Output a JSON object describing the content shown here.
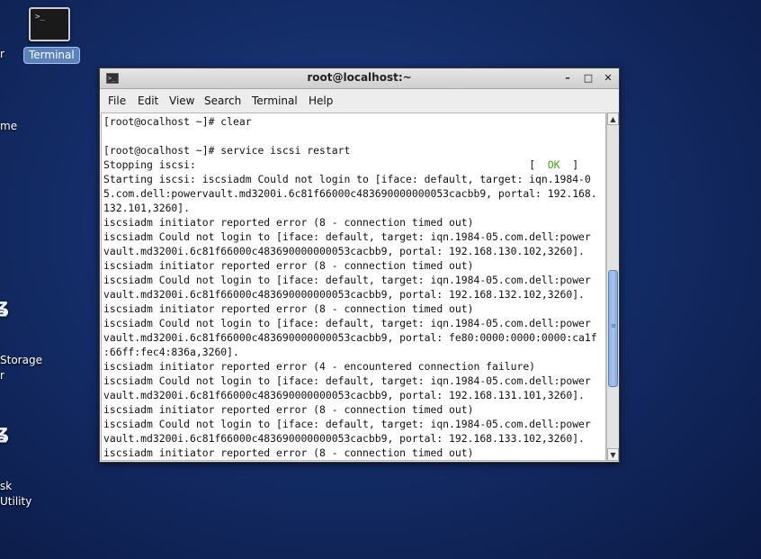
{
  "desktop": {
    "partial_labels": [
      "r",
      "me",
      "Storage",
      "r",
      "sk",
      "Utility"
    ],
    "terminal_icon_label": "Terminal"
  },
  "window": {
    "title": "root@localhost:~",
    "buttons": {
      "minimize": "–",
      "maximize": "□",
      "close": "✕"
    }
  },
  "menu": [
    "File",
    "Edit",
    "View",
    "Search",
    "Terminal",
    "Help"
  ],
  "terminal": {
    "lines": [
      "[root@ocalhost ~]# clear",
      "",
      "[root@ocalhost ~]# service iscsi restart",
      "Stopping iscsi:",
      "Starting iscsi: iscsiadm Could not login to [iface: default, target: iqn.1984-0",
      "5.com.dell:powervault.md3200i.6c81f66000c483690000000053cacbb9, portal: 192.168.",
      "132.101,3260].",
      "iscsiadm initiator reported error (8 - connection timed out)",
      "iscsiadm Could not login to [iface: default, target: iqn.1984-05.com.dell:power",
      "vault.md3200i.6c81f66000c483690000000053cacbb9, portal: 192.168.130.102,3260].",
      "iscsiadm initiator reported error (8 - connection timed out)",
      "iscsiadm Could not login to [iface: default, target: iqn.1984-05.com.dell:power",
      "vault.md3200i.6c81f66000c483690000000053cacbb9, portal: 192.168.132.102,3260].",
      "iscsiadm initiator reported error (8 - connection timed out)",
      "iscsiadm Could not login to [iface: default, target: iqn.1984-05.com.dell:power",
      "vault.md3200i.6c81f66000c483690000000053cacbb9, portal: fe80:0000:0000:0000:ca1f",
      ":66ff:fec4:836a,3260].",
      "iscsiadm initiator reported error (4 - encountered connection failure)",
      "iscsiadm Could not login to [iface: default, target: iqn.1984-05.com.dell:power",
      "vault.md3200i.6c81f66000c483690000000053cacbb9, portal: 192.168.131.101,3260].",
      "iscsiadm initiator reported error (8 - connection timed out)",
      "iscsiadm Could not login to [iface: default, target: iqn.1984-05.com.dell:power",
      "vault.md3200i.6c81f66000c483690000000053cacbb9, portal: 192.168.133.102,3260].",
      "iscsiadm initiator reported error (8 - connection timed out)"
    ],
    "stopping_status": "[  OK  ]",
    "ok_color": "#44a30f"
  },
  "scrollbar": {
    "position_fraction": 0.6,
    "visible_fraction": 0.35
  }
}
